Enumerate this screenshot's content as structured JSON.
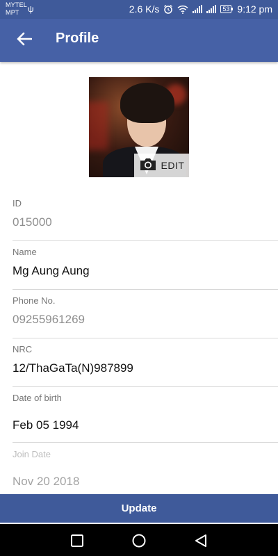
{
  "status_bar": {
    "carrier_line1": "MYTEL",
    "carrier_line2": "MPT",
    "speed": "2.6 K/s",
    "battery": "53",
    "time": "9:12 pm"
  },
  "header": {
    "title": "Profile"
  },
  "avatar": {
    "edit_label": "EDIT"
  },
  "fields": [
    {
      "label": "ID",
      "value": "015000"
    },
    {
      "label": "Name",
      "value": "Mg Aung Aung"
    },
    {
      "label": "Phone No.",
      "value": "09255961269"
    },
    {
      "label": "NRC",
      "value": "12/ThaGaTa(N)987899"
    },
    {
      "label": "Date of birth",
      "value": "Feb 05 1994"
    },
    {
      "label": "Join Date",
      "value": "Nov 20 2018"
    }
  ],
  "actions": {
    "update_label": "Update"
  },
  "colors": {
    "primary": "#4661a6",
    "primary_dark": "#3f5a9a"
  }
}
